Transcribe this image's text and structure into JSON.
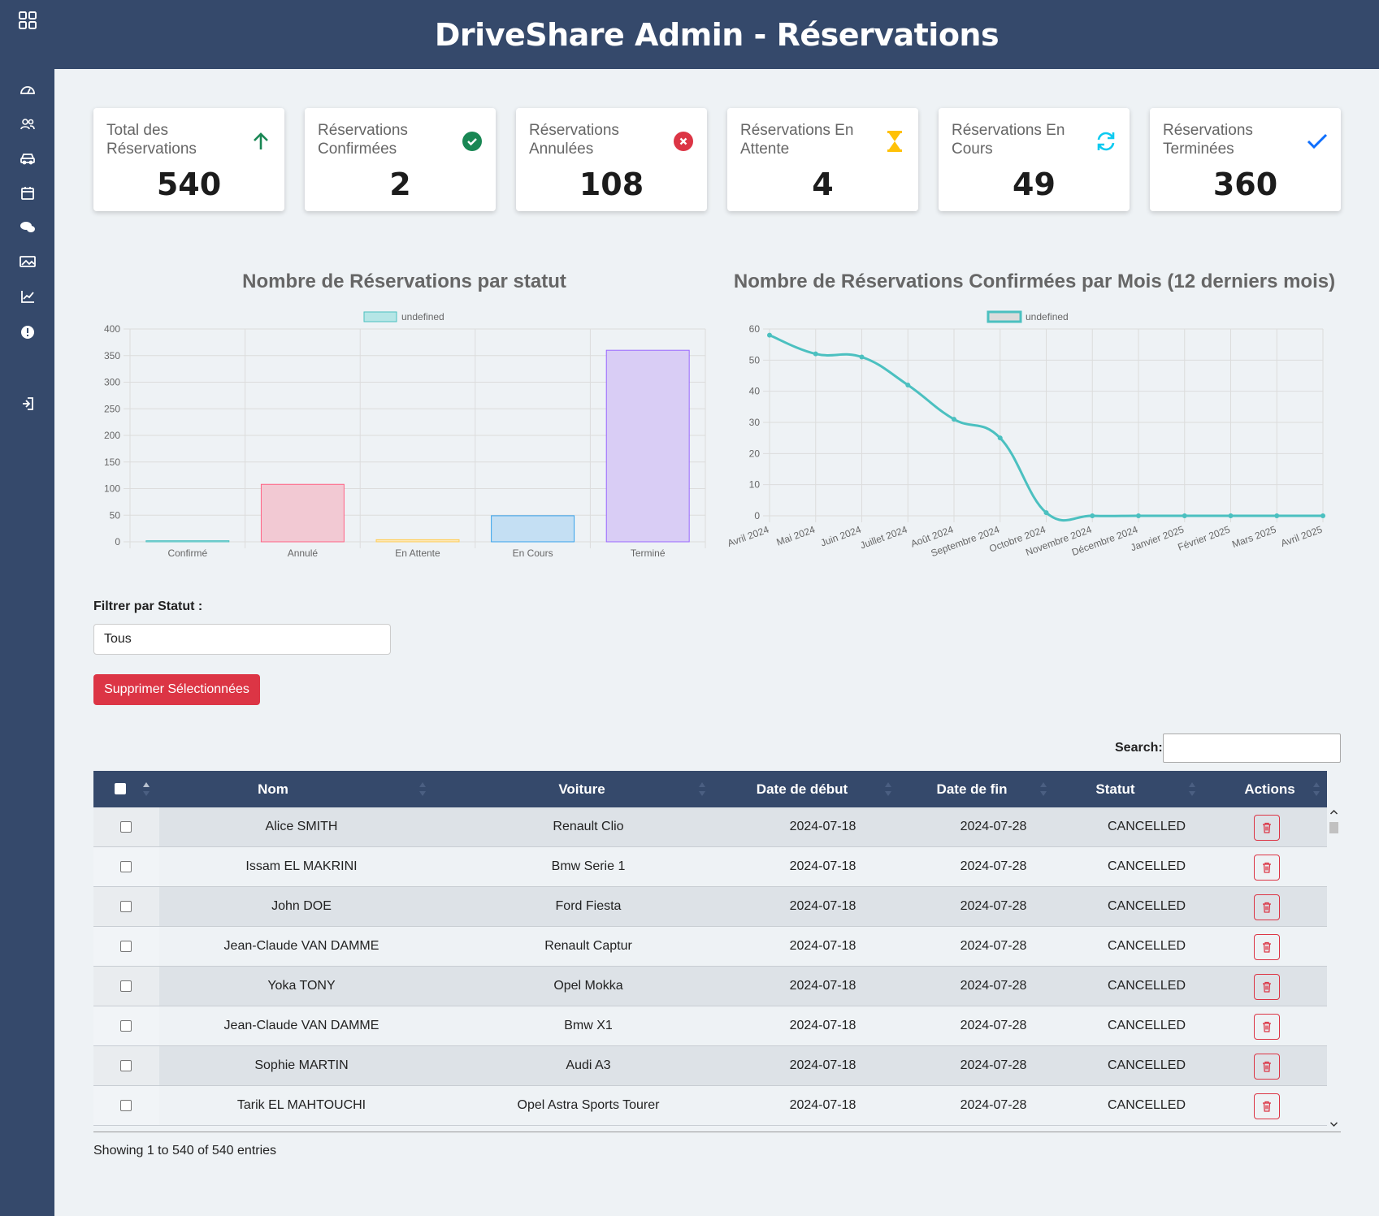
{
  "header": {
    "title": "DriveShare Admin - Réservations"
  },
  "sidebar": {
    "icons": [
      "grid-icon",
      "dashboard-icon",
      "users-icon",
      "car-icon",
      "calendar-icon",
      "chat-icon",
      "gallery-icon",
      "chart-icon",
      "alert-icon",
      "logout-icon"
    ]
  },
  "stats": [
    {
      "label": "Total des Réservations",
      "value": "540",
      "icon": "arrow-up-icon",
      "color": "#198754"
    },
    {
      "label": "Réservations Confirmées",
      "value": "2",
      "icon": "check-circle-icon",
      "color": "#198754"
    },
    {
      "label": "Réservations Annulées",
      "value": "108",
      "icon": "x-circle-icon",
      "color": "#dc3545"
    },
    {
      "label": "Réservations En Attente",
      "value": "4",
      "icon": "hourglass-icon",
      "color": "#ffc107"
    },
    {
      "label": "Réservations En Cours",
      "value": "49",
      "icon": "refresh-icon",
      "color": "#0dcaf0"
    },
    {
      "label": "Réservations Terminées",
      "value": "360",
      "icon": "check-icon",
      "color": "#0d6efd"
    }
  ],
  "chart_data": [
    {
      "type": "bar",
      "title": "Nombre de Réservations par statut",
      "legend": "undefined",
      "legend_position": "top",
      "categories": [
        "Confirmé",
        "Annulé",
        "En Attente",
        "En Cours",
        "Terminé"
      ],
      "values": [
        2,
        108,
        4,
        49,
        360
      ],
      "ylim": [
        0,
        400
      ],
      "yticks": [
        0,
        50,
        100,
        150,
        200,
        250,
        300,
        350,
        400
      ],
      "grid": true,
      "colors": [
        "#b5e6e6",
        "#f2c9d3",
        "#fde8b8",
        "#c4dff3",
        "#d9cdf5"
      ],
      "borders": [
        "#4bc0c0",
        "#ff6384",
        "#ffcd56",
        "#36a2eb",
        "#9966ff"
      ]
    },
    {
      "type": "line",
      "title": "Nombre de Réservations Confirmées par Mois (12 derniers mois)",
      "legend": "undefined",
      "legend_position": "top",
      "categories": [
        "Avril 2024",
        "Mai 2024",
        "Juin 2024",
        "Juillet 2024",
        "Août 2024",
        "Septembre 2024",
        "Octobre 2024",
        "Novembre 2024",
        "Décembre 2024",
        "Janvier 2025",
        "Février 2025",
        "Mars 2025",
        "Avril 2025"
      ],
      "values": [
        58,
        52,
        51,
        42,
        31,
        25,
        1,
        0,
        0,
        0,
        0,
        0,
        0
      ],
      "ylim": [
        0,
        60
      ],
      "yticks": [
        0,
        10,
        20,
        30,
        40,
        50,
        60
      ],
      "grid": true,
      "color": "#4bc0c0"
    }
  ],
  "filter": {
    "label": "Filtrer par Statut :",
    "value": "Tous"
  },
  "actions": {
    "delete_selected": "Supprimer Sélectionnées"
  },
  "search": {
    "label": "Search:",
    "value": ""
  },
  "table": {
    "columns": [
      "Nom",
      "Voiture",
      "Date de début",
      "Date de fin",
      "Statut",
      "Actions"
    ],
    "rows": [
      [
        "Alice SMITH",
        "Renault Clio",
        "2024-07-18",
        "2024-07-28",
        "CANCELLED"
      ],
      [
        "Issam EL MAKRINI",
        "Bmw Serie 1",
        "2024-07-18",
        "2024-07-28",
        "CANCELLED"
      ],
      [
        "John DOE",
        "Ford Fiesta",
        "2024-07-18",
        "2024-07-28",
        "CANCELLED"
      ],
      [
        "Jean-Claude VAN DAMME",
        "Renault Captur",
        "2024-07-18",
        "2024-07-28",
        "CANCELLED"
      ],
      [
        "Yoka TONY",
        "Opel Mokka",
        "2024-07-18",
        "2024-07-28",
        "CANCELLED"
      ],
      [
        "Jean-Claude VAN DAMME",
        "Bmw X1",
        "2024-07-18",
        "2024-07-28",
        "CANCELLED"
      ],
      [
        "Sophie MARTIN",
        "Audi A3",
        "2024-07-18",
        "2024-07-28",
        "CANCELLED"
      ],
      [
        "Tarik EL MAHTOUCHI",
        "Opel Astra Sports Tourer",
        "2024-07-18",
        "2024-07-28",
        "CANCELLED"
      ]
    ],
    "info": "Showing 1 to 540 of 540 entries"
  }
}
